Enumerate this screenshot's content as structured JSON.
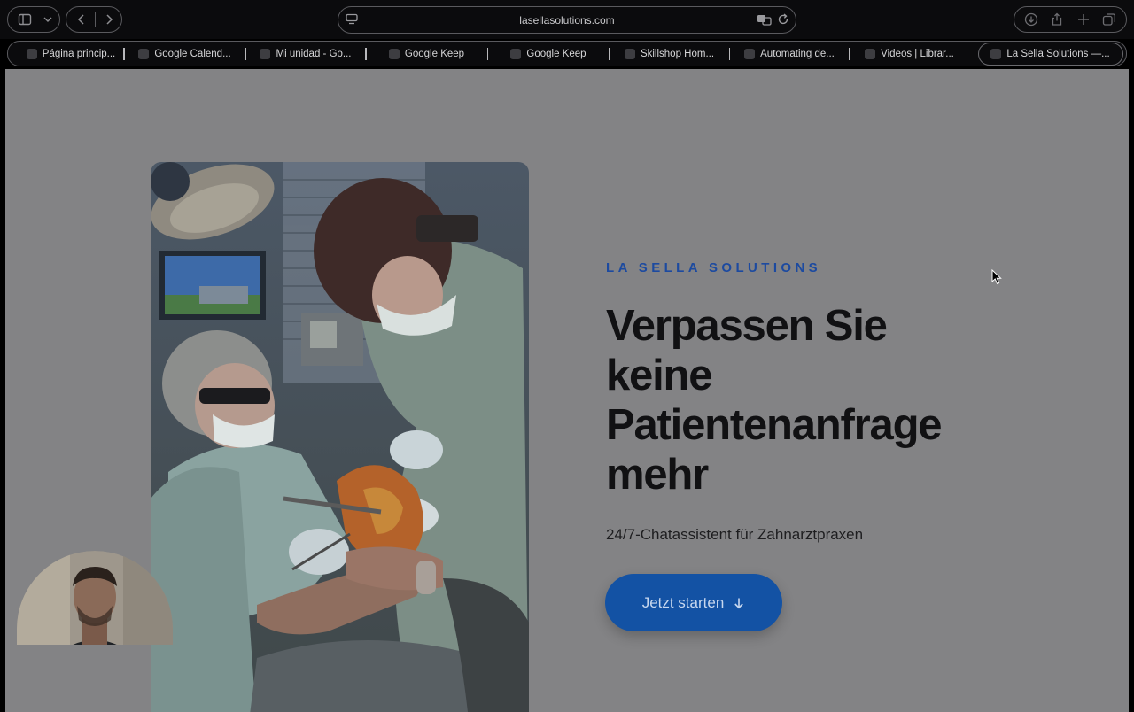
{
  "browser": {
    "url": "lasellasolutions.com",
    "tabs": [
      {
        "label": "Página princip...",
        "icon": "drive-icon"
      },
      {
        "label": "Google Calend...",
        "icon": "calendar-icon"
      },
      {
        "label": "Mi unidad - Go...",
        "icon": "drive-icon"
      },
      {
        "label": "Google Keep",
        "icon": "keep-icon"
      },
      {
        "label": "Google Keep",
        "icon": "keep-icon"
      },
      {
        "label": "Skillshop Hom...",
        "icon": "skillshop-icon"
      },
      {
        "label": "Automating de...",
        "icon": "page-icon"
      },
      {
        "label": "Videos | Librar...",
        "icon": "video-icon"
      },
      {
        "label": "La Sella Solutions —...",
        "icon": "page-icon"
      }
    ],
    "active_tab": 8
  },
  "hero": {
    "brand": "LA SELLA SOLUTIONS",
    "headline": "Verpassen Sie keine Patientenanfrage mehr",
    "subline": "24/7-Chatassistent für Zahnarztpraxen",
    "cta_label": "Jetzt starten",
    "cta_icon": "arrow-down-icon",
    "image": "dentist-treating-patient-photo"
  },
  "colors": {
    "accent": "#1352a4",
    "brand_text": "#1c4aa0",
    "overlay_bg": "#838385"
  }
}
